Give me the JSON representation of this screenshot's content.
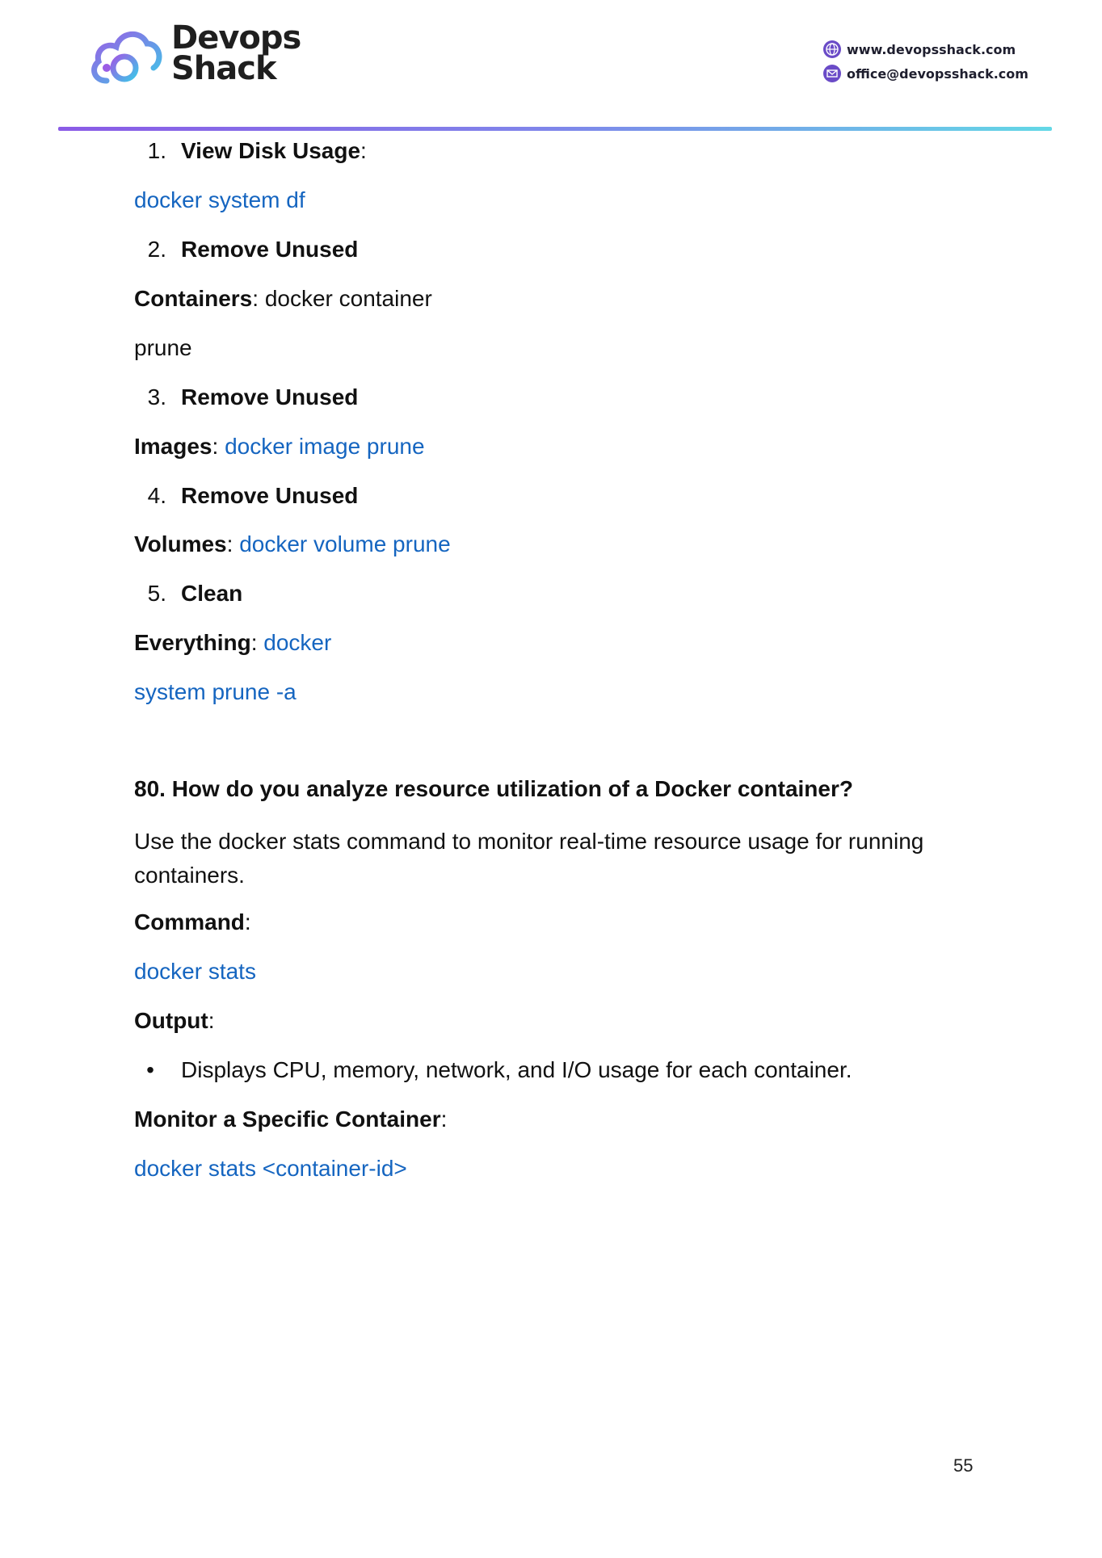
{
  "header": {
    "logo_line1": "Devops",
    "logo_line2": "Shack",
    "website": "www.devopsshack.com",
    "email": "office@devopsshack.com"
  },
  "content": {
    "item1_num": "1.",
    "item1_label": "View Disk Usage",
    "item1_colon": ":",
    "item1_code": "docker system df",
    "item2_num": "2.",
    "item2_label": "Remove Unused",
    "item2_label_cont": "Containers",
    "item2_colon": ": ",
    "item2_text1": "docker container",
    "item2_text2": "prune",
    "item3_num": "3.",
    "item3_label": "Remove Unused",
    "item3_label_cont": "Images",
    "item3_colon": ": ",
    "item3_code": "docker image prune",
    "item4_num": "4.",
    "item4_label": "Remove Unused",
    "item4_label_cont": "Volumes",
    "item4_colon": ": ",
    "item4_code": "docker volume prune",
    "item5_num": "5.",
    "item5_label": "Clean",
    "item5_label_cont": "Everything",
    "item5_colon": ": ",
    "item5_code1": "docker",
    "item5_code2": "system prune -a",
    "q80_heading": "80. How do you analyze resource utilization of a Docker container?",
    "q80_intro": "Use the docker stats command to monitor real-time resource usage for running containers.",
    "command_label": "Command",
    "command_colon": ":",
    "command_code": "docker stats",
    "output_label": "Output",
    "output_colon": ":",
    "output_bullet_glyph": "•",
    "output_bullet": "Displays CPU, memory, network, and I/O usage for each container.",
    "monitor_label": "Monitor a Specific Container",
    "monitor_colon": ":",
    "monitor_code": "docker stats <container-id>"
  },
  "footer": {
    "page_number": "55"
  },
  "colors": {
    "code": "#1565c0",
    "rule_start": "#8a5be6",
    "rule_end": "#63d8e6"
  },
  "icons": {
    "website": "globe-icon",
    "email": "mail-icon"
  }
}
